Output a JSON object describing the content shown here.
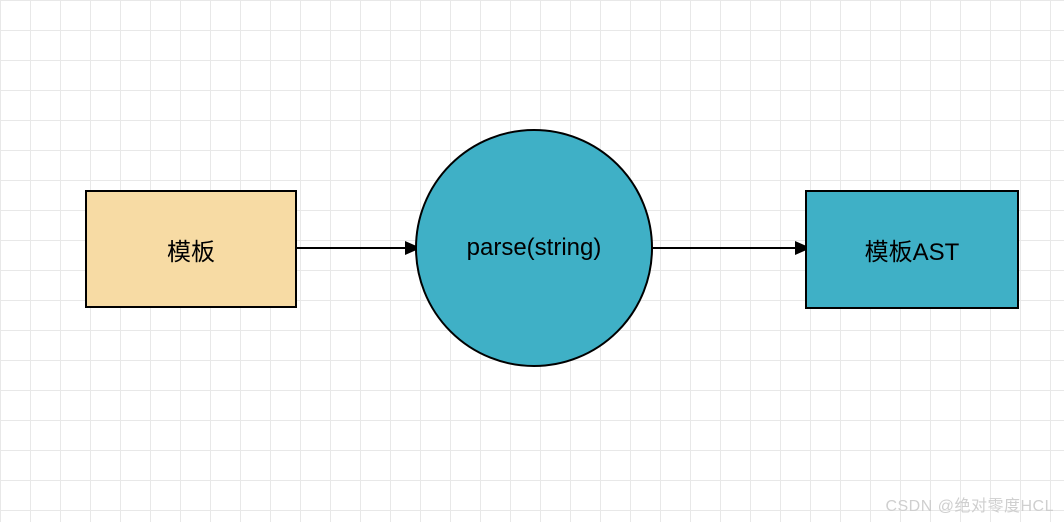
{
  "diagram": {
    "nodes": {
      "left": {
        "label": "模板"
      },
      "middle": {
        "label": "parse(string)"
      },
      "right": {
        "label": "模板AST"
      }
    }
  },
  "watermark": {
    "text": "CSDN @绝对零度HCL"
  }
}
